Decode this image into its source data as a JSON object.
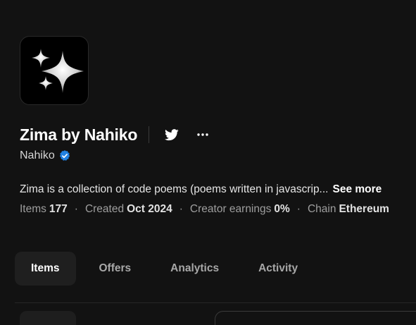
{
  "collection": {
    "title": "Zima by Nahiko",
    "creator": "Nahiko",
    "description": "Zima is a collection of code poems (poems written in javascrip...",
    "see_more": "See more"
  },
  "icons": {
    "avatar": "sparkles-icon",
    "twitter": "twitter-icon",
    "more": "more-horizontal-icon",
    "verified": "verified-badge-icon"
  },
  "stats": [
    {
      "label": "Items",
      "value": "177"
    },
    {
      "label": "Created",
      "value": "Oct 2024"
    },
    {
      "label": "Creator earnings",
      "value": "0%"
    },
    {
      "label": "Chain",
      "value": "Ethereum"
    }
  ],
  "stats_separator": "·",
  "tabs": [
    {
      "label": "Items"
    },
    {
      "label": "Offers"
    },
    {
      "label": "Analytics"
    },
    {
      "label": "Activity"
    }
  ],
  "colors": {
    "background": "#121212",
    "verified": "#2081e2",
    "active_tab_bg": "#1f1f1f"
  }
}
